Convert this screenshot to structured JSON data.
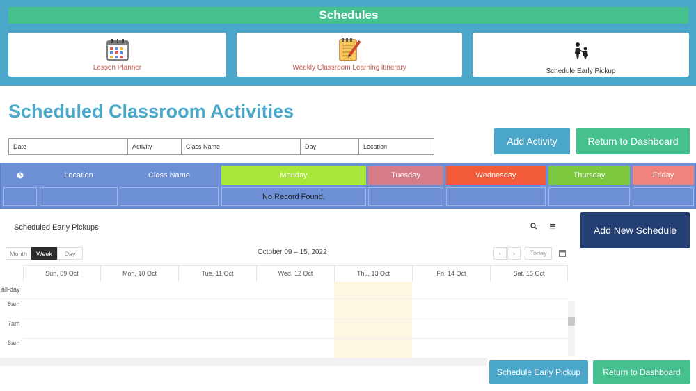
{
  "header": {
    "title": "Schedules"
  },
  "cards": [
    {
      "label": "Lesson Planner",
      "icon": "calendar-icon"
    },
    {
      "label": "Weekly Classroom Learning itinerary",
      "icon": "notepad-icon"
    },
    {
      "label": "Schedule Early Pickup",
      "icon": "parent-child-icon"
    }
  ],
  "page": {
    "title": "Scheduled Classroom Activities"
  },
  "filters": {
    "date": "Date",
    "activity": "Activity",
    "class_name": "Class Name",
    "day": "Day",
    "location": "Location"
  },
  "buttons": {
    "add_activity": "Add Activity",
    "return_dashboard_top": "Return to Dashboard",
    "add_new_schedule": "Add New Schedule",
    "schedule_early_pickup": "Schedule Early Pickup",
    "return_dashboard_bottom": "Return to Dashboard"
  },
  "week_table": {
    "columns": {
      "location": "Location",
      "class_name": "Class Name",
      "monday": "Monday",
      "tuesday": "Tuesday",
      "wednesday": "Wednesday",
      "thursday": "Thursday",
      "friday": "Friday"
    },
    "empty_text": "No Record Found.",
    "colors": {
      "monday": "#a8e63a",
      "tuesday": "#d57c86",
      "wednesday": "#f25a3a",
      "thursday": "#7cc83e",
      "friday": "#f0837c",
      "table": "#6d8fd6"
    }
  },
  "calendar": {
    "title": "Scheduled Early Pickups",
    "views": {
      "month": "Month",
      "week": "Week",
      "day": "Day"
    },
    "active_view": "Week",
    "range": "October 09 – 15, 2022",
    "today_label": "Today",
    "days": [
      "Sun, 09 Oct",
      "Mon, 10 Oct",
      "Tue, 11 Oct",
      "Wed, 12 Oct",
      "Thu, 13 Oct",
      "Fri, 14 Oct",
      "Sat, 15 Oct"
    ],
    "allday_label": "all-day",
    "times": [
      "6am",
      "7am",
      "8am"
    ]
  }
}
